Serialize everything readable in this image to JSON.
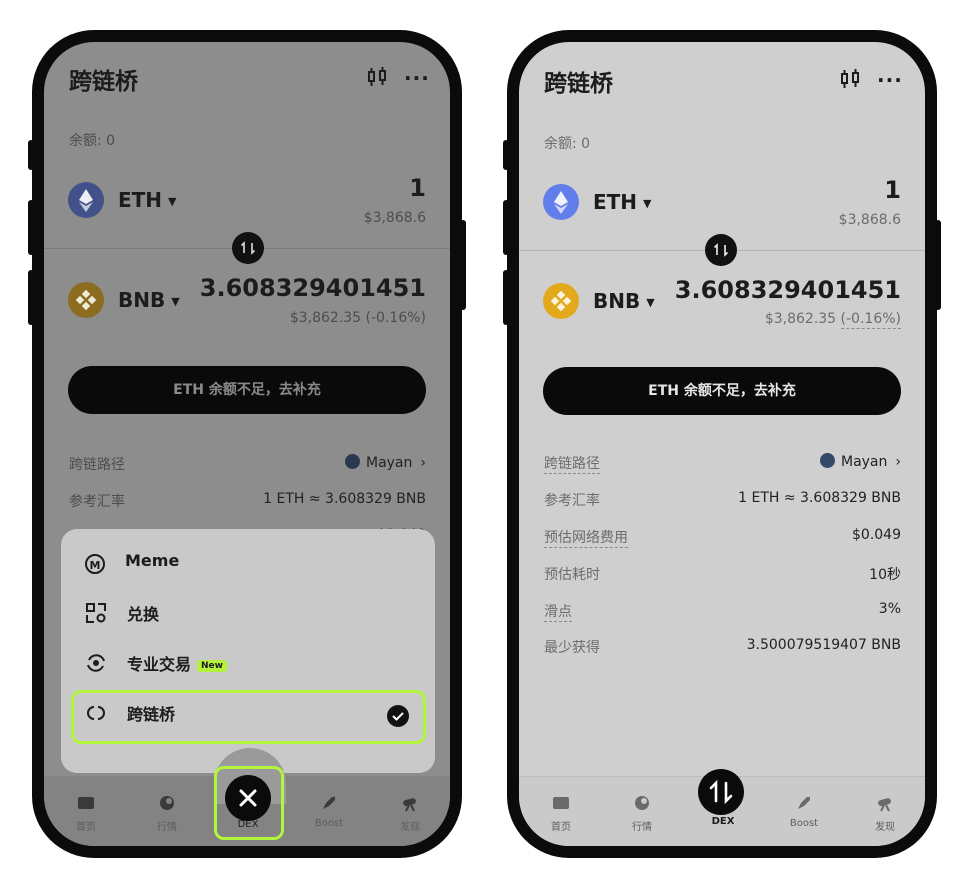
{
  "app": {
    "title": "跨链桥"
  },
  "balance": {
    "label": "余额: 0"
  },
  "from_token": {
    "symbol": "ETH",
    "amount": "1",
    "usd": "$3,868.6"
  },
  "to_token": {
    "symbol": "BNB",
    "amount": "3.608329401451",
    "usd": "$3,862.35",
    "change": "(-0.16%)"
  },
  "cta": {
    "label": "ETH 余额不足，去补充"
  },
  "details": {
    "route_label": "跨链路径",
    "route_value": "Mayan",
    "rate_label": "参考汇率",
    "rate_value": "1 ETH ≈ 3.608329 BNB",
    "fee_label": "预估网络费用",
    "fee_value": "$0.049",
    "time_label": "预估耗时",
    "time_value": "10秒",
    "slippage_label": "滑点",
    "slippage_value": "3%",
    "min_label": "最少获得",
    "min_value": "3.500079519407 BNB"
  },
  "menu": {
    "items": [
      {
        "label": "Meme"
      },
      {
        "label": "兑换"
      },
      {
        "label": "专业交易",
        "badge": "New"
      },
      {
        "label": "跨链桥",
        "selected": true
      }
    ]
  },
  "tabs": [
    {
      "label": "首页"
    },
    {
      "label": "行情"
    },
    {
      "label": "DEX"
    },
    {
      "label": "Boost"
    },
    {
      "label": "发现"
    }
  ],
  "colors": {
    "highlight": "#b3f53b",
    "dark": "#0b0b0b",
    "eth": "#627eea",
    "bnb": "#e3a91c"
  }
}
